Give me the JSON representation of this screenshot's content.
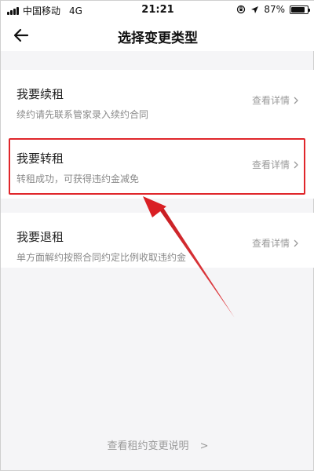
{
  "status_bar": {
    "carrier": "中国移动",
    "network": "4G",
    "time": "21:21",
    "battery_percent": "87%",
    "battery_level": 0.87
  },
  "nav": {
    "title": "选择变更类型",
    "back_icon": "arrow-left-icon"
  },
  "options": [
    {
      "title": "我要续租",
      "desc": "续约请先联系管家录入续约合同",
      "detail": "查看详情"
    },
    {
      "title": "我要转租",
      "desc": "转租成功，可获得违约金减免",
      "detail": "查看详情"
    },
    {
      "title": "我要退租",
      "desc": "单方面解约按照合同约定比例收取违约金",
      "detail": "查看详情"
    }
  ],
  "footer": {
    "link": "查看租约变更说明",
    "chevron": ">"
  },
  "colors": {
    "annotation_red": "#e0262b",
    "background": "#f5f5f7",
    "muted_text": "#8a8a8a"
  }
}
